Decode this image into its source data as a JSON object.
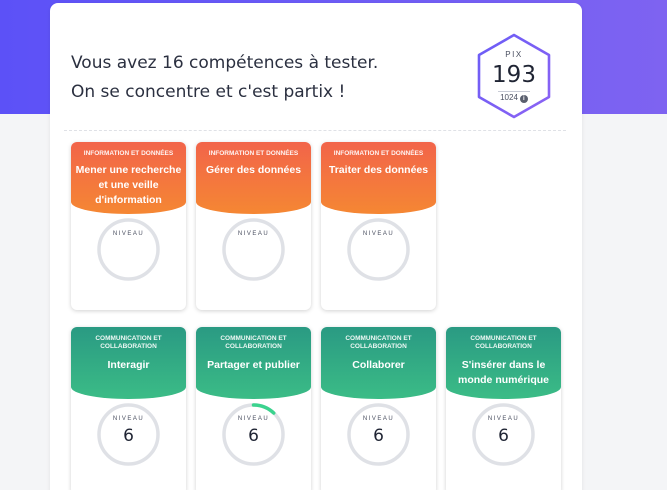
{
  "header": {
    "line1": "Vous avez 16 compétences à tester.",
    "line2": "On se concentre et c'est partix !"
  },
  "pix": {
    "label": "PIX",
    "score": "193",
    "max": "1024",
    "info_icon": "info-icon"
  },
  "colors": {
    "banner": "#5c51f7",
    "orange_top": "#f2644a",
    "orange_bottom": "#f58733",
    "green_top": "#2a9a83",
    "green_bottom": "#3bbc86",
    "gauge_track": "#dfe1e6",
    "gauge_progress": "#3bd38e"
  },
  "cards": [
    {
      "domain": "INFORMATION ET DONNÉES",
      "title": "Mener une recherche et une veille d'information",
      "niveau_label": "NIVEAU",
      "level": "",
      "progress": 0,
      "color": "orange"
    },
    {
      "domain": "INFORMATION ET DONNÉES",
      "title": "Gérer des données",
      "niveau_label": "NIVEAU",
      "level": "",
      "progress": 0,
      "color": "orange"
    },
    {
      "domain": "INFORMATION ET DONNÉES",
      "title": "Traiter des données",
      "niveau_label": "NIVEAU",
      "level": "",
      "progress": 0,
      "color": "orange"
    },
    {
      "domain": "COMMUNICATION ET COLLABORATION",
      "title": "Interagir",
      "niveau_label": "NIVEAU",
      "level": "6",
      "progress": 0,
      "color": "green"
    },
    {
      "domain": "COMMUNICATION ET COLLABORATION",
      "title": "Partager et publier",
      "niveau_label": "NIVEAU",
      "level": "6",
      "progress": 0.12,
      "color": "green"
    },
    {
      "domain": "COMMUNICATION ET COLLABORATION",
      "title": "Collaborer",
      "niveau_label": "NIVEAU",
      "level": "6",
      "progress": 0,
      "color": "green"
    },
    {
      "domain": "COMMUNICATION ET COLLABORATION",
      "title": "S'insérer dans le monde numérique",
      "niveau_label": "NIVEAU",
      "level": "6",
      "progress": 0,
      "color": "green"
    }
  ]
}
